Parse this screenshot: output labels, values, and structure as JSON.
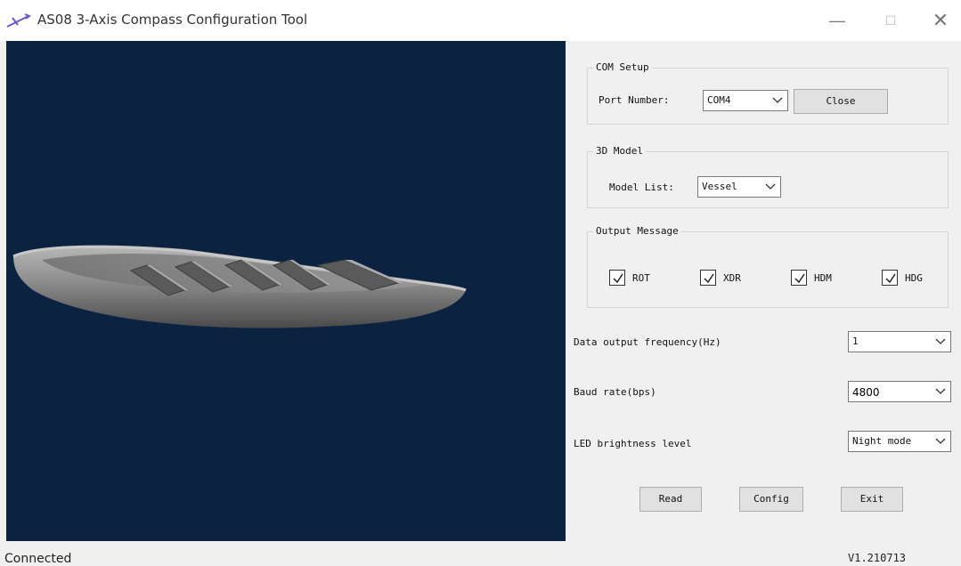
{
  "window": {
    "title": "AS08 3-Axis Compass Configuration Tool",
    "minimize_glyph": "—",
    "maximize_glyph": "☐",
    "close_glyph": "✕",
    "app_icon": "compass-arrow-icon"
  },
  "com_setup": {
    "legend": "COM Setup",
    "port_label": "Port Number:",
    "port_value": "COM4",
    "close_label": "Close"
  },
  "model": {
    "legend": "3D Model",
    "list_label": "Model List:",
    "list_value": "Vessel"
  },
  "output": {
    "legend": "Output Message",
    "items": [
      {
        "label": "ROT",
        "checked": true
      },
      {
        "label": "XDR",
        "checked": true
      },
      {
        "label": "HDM",
        "checked": true
      },
      {
        "label": "HDG",
        "checked": true
      }
    ]
  },
  "settings": {
    "frequency_label": "Data output frequency(Hz)",
    "frequency_value": "1",
    "baud_label": "Baud rate(bps)",
    "baud_value": "4800",
    "led_label": "LED brightness level",
    "led_value": "Night mode"
  },
  "actions": {
    "read_label": "Read",
    "config_label": "Config",
    "exit_label": "Exit"
  },
  "status": {
    "text": "Connected",
    "version": "V1.210713"
  },
  "colors": {
    "viewport_bg": "#0b2340",
    "hull": "#8a8a8a"
  }
}
